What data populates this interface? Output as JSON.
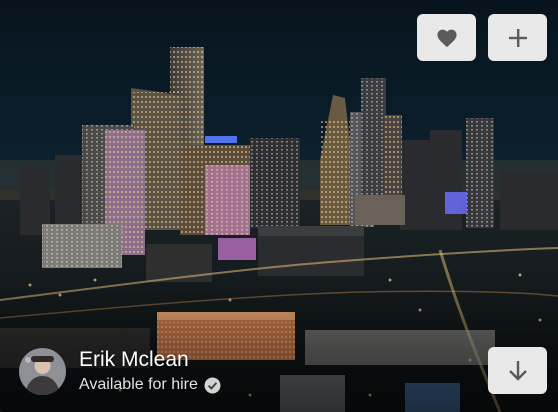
{
  "photo": {
    "subject": "Night aerial city skyline",
    "colors": {
      "sky": "#0a1a26",
      "glow": "#f3b46a",
      "accent_blue": "#5b7dff",
      "accent_pink": "#d27ad8"
    }
  },
  "actions": {
    "like": {
      "icon": "heart-icon"
    },
    "add": {
      "icon": "plus-icon"
    },
    "download": {
      "icon": "arrow-down-icon"
    }
  },
  "author": {
    "name": "Erik Mclean",
    "hire_status": "Available for hire",
    "avatar_icon": "avatar",
    "badge_icon": "check-circle-icon"
  }
}
